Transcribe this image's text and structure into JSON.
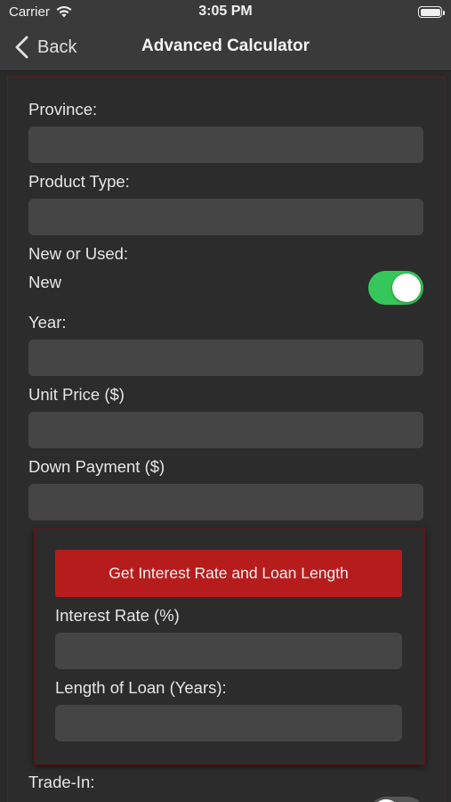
{
  "status_bar": {
    "carrier": "Carrier",
    "time": "3:05 PM",
    "wifi_icon": "wifi-icon",
    "battery_icon": "battery-icon"
  },
  "nav": {
    "back_label": "Back",
    "back_icon": "chevron-left-icon",
    "title": "Advanced Calculator"
  },
  "form": {
    "province": {
      "label": "Province:",
      "value": ""
    },
    "product_type": {
      "label": "Product Type:",
      "value": ""
    },
    "new_or_used": {
      "label": "New or Used:",
      "option_label": "New",
      "toggle_on": true
    },
    "year": {
      "label": "Year:",
      "value": ""
    },
    "unit_price": {
      "label": "Unit Price ($)",
      "value": ""
    },
    "down_payment": {
      "label": "Down Payment ($)",
      "value": ""
    },
    "rate_section": {
      "button_label": "Get Interest Rate and Loan Length",
      "interest_rate": {
        "label": "Interest Rate (%)",
        "value": ""
      },
      "loan_length": {
        "label": "Length of Loan (Years):",
        "value": ""
      }
    },
    "trade_in": {
      "label": "Trade-In:",
      "toggle_on": false
    }
  },
  "colors": {
    "accent_red": "#b71c1c",
    "panel_border": "#7a1414",
    "toggle_on": "#35c759",
    "background": "#2a2a2a",
    "field": "#454545"
  }
}
